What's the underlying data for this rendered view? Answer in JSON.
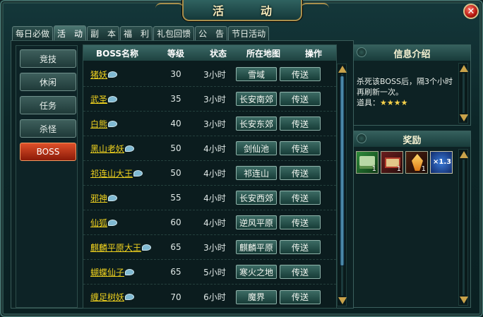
{
  "window": {
    "title": "活　动",
    "close_label": "✕"
  },
  "tabs": [
    {
      "label": "每日必做",
      "active": false
    },
    {
      "label": "活　动",
      "active": true
    },
    {
      "label": "副　本",
      "active": false
    },
    {
      "label": "福　利",
      "active": false
    },
    {
      "label": "礼包回馈",
      "active": false
    },
    {
      "label": "公　告",
      "active": false
    },
    {
      "label": "节日活动",
      "active": false
    }
  ],
  "sidebar": {
    "items": [
      {
        "label": "竞技",
        "active": false
      },
      {
        "label": "休闲",
        "active": false
      },
      {
        "label": "任务",
        "active": false
      },
      {
        "label": "杀怪",
        "active": false
      },
      {
        "label": "BOSS",
        "active": true
      }
    ]
  },
  "table": {
    "headers": [
      "BOSS名称",
      "等级",
      "状态",
      "所在地图",
      "操作"
    ],
    "action_label": "传送",
    "rows": [
      {
        "name": "猪妖",
        "level": "30",
        "status": "3小时",
        "map": "雪域"
      },
      {
        "name": "武圣",
        "level": "35",
        "status": "3小时",
        "map": "长安南郊"
      },
      {
        "name": "白熊",
        "level": "40",
        "status": "3小时",
        "map": "长安东郊"
      },
      {
        "name": "黑山老妖",
        "level": "50",
        "status": "4小时",
        "map": "剑仙池"
      },
      {
        "name": "祁连山大王",
        "level": "50",
        "status": "4小时",
        "map": "祁连山"
      },
      {
        "name": "邪神",
        "level": "55",
        "status": "4小时",
        "map": "长安西郊"
      },
      {
        "name": "仙狐",
        "level": "60",
        "status": "4小时",
        "map": "逆风平原"
      },
      {
        "name": "麒麟平原大王",
        "level": "65",
        "status": "3小时",
        "map": "麒麟平原"
      },
      {
        "name": "蝴蝶仙子",
        "level": "65",
        "status": "5小时",
        "map": "寒火之地"
      },
      {
        "name": "缠足树妖",
        "level": "70",
        "status": "6小时",
        "map": "魔界"
      }
    ]
  },
  "info": {
    "title": "信息介绍",
    "line1": "杀死该BOSS后，隔3个小时",
    "line2": "再刷新一次。",
    "item_label": "道具：",
    "stars": "★★★★"
  },
  "reward": {
    "title": "奖励",
    "items": [
      {
        "icon": "green-mahjong-icon",
        "qty": "1"
      },
      {
        "icon": "red-chest-icon",
        "qty": "1"
      },
      {
        "icon": "gold-crystal-icon",
        "qty": "1"
      },
      {
        "icon": "blue-multiplier-icon",
        "qty": "×1.3"
      }
    ]
  }
}
